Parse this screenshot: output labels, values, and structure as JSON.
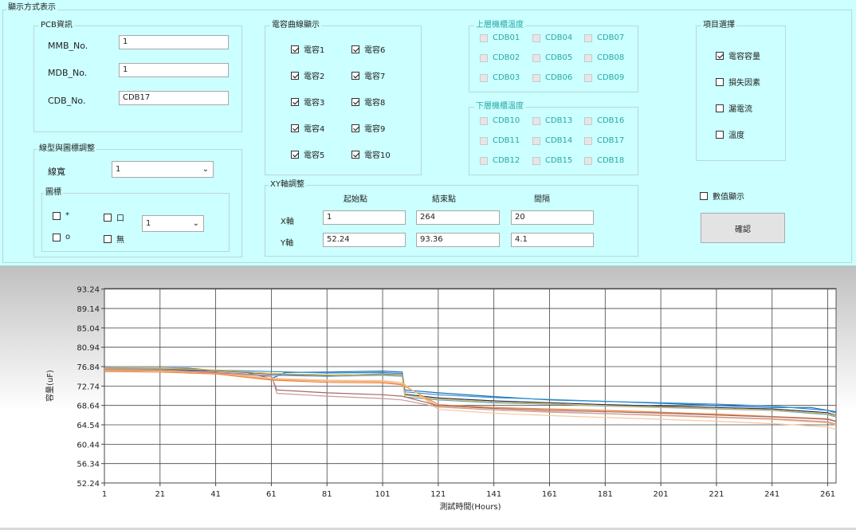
{
  "display_mode": {
    "title": "顯示方式表示"
  },
  "pcb": {
    "title": "PCB資訊",
    "mmb_label": "MMB_No.",
    "mmb_value": "1",
    "mdb_label": "MDB_No.",
    "mdb_value": "1",
    "cdb_label": "CDB_No.",
    "cdb_value": "CDB17"
  },
  "curves": {
    "title": "電容曲線顯示",
    "items": [
      {
        "label": "電容1",
        "checked": true
      },
      {
        "label": "電容2",
        "checked": true
      },
      {
        "label": "電容3",
        "checked": true
      },
      {
        "label": "電容4",
        "checked": true
      },
      {
        "label": "電容5",
        "checked": true
      },
      {
        "label": "電容6",
        "checked": true
      },
      {
        "label": "電容7",
        "checked": true
      },
      {
        "label": "電容8",
        "checked": true
      },
      {
        "label": "電容9",
        "checked": true
      },
      {
        "label": "電容10",
        "checked": true
      }
    ]
  },
  "upper_temp": {
    "title": "上層機櫃溫度",
    "items": [
      "CDB01",
      "CDB04",
      "CDB07",
      "CDB02",
      "CDB05",
      "CDB08",
      "CDB03",
      "CDB06",
      "CDB09"
    ]
  },
  "lower_temp": {
    "title": "下層機櫃溫度",
    "items": [
      "CDB10",
      "CDB13",
      "CDB16",
      "CDB11",
      "CDB14",
      "CDB17",
      "CDB12",
      "CDB15",
      "CDB18"
    ]
  },
  "items_select": {
    "title": "項目選擇",
    "items": [
      {
        "label": "電容容量",
        "checked": true
      },
      {
        "label": "損失因素",
        "checked": false
      },
      {
        "label": "漏電流",
        "checked": false
      },
      {
        "label": "溫度",
        "checked": false
      }
    ]
  },
  "line_style": {
    "title": "線型與圖標調整",
    "width_label": "線寬",
    "width_value": "1",
    "icon_title": "圖標",
    "icon_opts": [
      {
        "label": "*",
        "checked": false
      },
      {
        "label": "口",
        "checked": false
      },
      {
        "label": "o",
        "checked": false
      },
      {
        "label": "無",
        "checked": false
      }
    ],
    "icon_size_value": "1"
  },
  "xy": {
    "title": "XY軸調整",
    "col_start": "起始點",
    "col_end": "結束點",
    "col_interval": "間隔",
    "x_label": "X軸",
    "x_start": "1",
    "x_end": "264",
    "x_interval": "20",
    "y_label": "Y軸",
    "y_start": "52.24",
    "y_end": "93.36",
    "y_interval": "4.1"
  },
  "value_display": {
    "label": "數值顯示",
    "checked": false
  },
  "confirm_button": "確認",
  "colors": {
    "panel_bg": "#ccffff",
    "disabled_text": "#2aa7a7"
  },
  "chart_data": {
    "type": "line",
    "xlabel": "測試時間(Hours)",
    "ylabel": "容量(uF)",
    "xlim": [
      1,
      264
    ],
    "ylim": [
      52.24,
      93.36
    ],
    "xticks": [
      1,
      21,
      41,
      61,
      81,
      101,
      121,
      141,
      161,
      181,
      201,
      221,
      241,
      261
    ],
    "yticks": [
      "52.24",
      "56.34",
      "60.44",
      "64.54",
      "68.64",
      "72.74",
      "76.84",
      "80.94",
      "85.04",
      "89.14",
      "93.24"
    ],
    "grid": true,
    "series": [
      {
        "color": "#1f6fb4",
        "x": [
          1,
          31,
          41,
          51,
          61,
          66,
          81,
          101,
          108,
          109,
          121,
          141,
          161,
          181,
          201,
          221,
          241,
          255,
          264
        ],
        "values": [
          76.6,
          76.5,
          76.0,
          75.8,
          74.3,
          75.6,
          75.7,
          75.9,
          75.7,
          71.9,
          71.3,
          70.5,
          69.8,
          69.5,
          69.1,
          68.6,
          68.2,
          68.2,
          67.3
        ]
      },
      {
        "color": "#2f8fd0",
        "x": [
          1,
          21,
          41,
          61,
          81,
          101,
          108,
          109,
          121,
          141,
          161,
          181,
          201,
          221,
          241,
          261,
          264
        ],
        "values": [
          76.4,
          76.4,
          76.1,
          75.8,
          75.5,
          75.6,
          75.4,
          71.5,
          70.9,
          70.3,
          69.9,
          69.5,
          69.2,
          68.9,
          68.5,
          67.6,
          67.0
        ]
      },
      {
        "color": "#1b2f6e",
        "x": [
          1,
          21,
          41,
          61,
          81,
          101,
          108,
          109,
          121,
          141,
          161,
          181,
          201,
          221,
          241,
          261,
          264
        ],
        "values": [
          76.3,
          76.2,
          76.0,
          75.3,
          75.0,
          75.3,
          75.1,
          71.0,
          70.2,
          69.6,
          69.2,
          68.8,
          68.5,
          68.2,
          67.9,
          67.1,
          66.5
        ]
      },
      {
        "color": "#5c9ecf",
        "x": [
          1,
          21,
          41,
          61,
          81,
          101,
          108,
          109,
          121,
          141,
          161,
          181,
          201,
          221,
          241,
          261,
          264
        ],
        "values": [
          76.2,
          76.1,
          75.7,
          75.0,
          74.8,
          75.0,
          74.8,
          70.4,
          69.8,
          69.2,
          68.9,
          68.5,
          68.2,
          67.9,
          67.6,
          66.7,
          66.2
        ]
      },
      {
        "color": "#f08030",
        "x": [
          1,
          21,
          41,
          61,
          81,
          101,
          108,
          121,
          141,
          161,
          181,
          201,
          221,
          241,
          261,
          264
        ],
        "values": [
          75.8,
          75.7,
          75.3,
          74.0,
          73.5,
          73.4,
          73.0,
          68.8,
          68.2,
          67.9,
          67.6,
          67.2,
          66.8,
          66.3,
          65.8,
          65.3
        ]
      },
      {
        "color": "#f4a56a",
        "x": [
          1,
          21,
          41,
          61,
          81,
          101,
          108,
          121,
          141,
          161,
          181,
          201,
          221,
          241,
          261,
          264
        ],
        "values": [
          76.0,
          75.9,
          75.5,
          74.2,
          73.8,
          73.7,
          73.2,
          68.3,
          67.7,
          67.3,
          66.9,
          66.5,
          66.1,
          65.7,
          65.0,
          64.5
        ]
      },
      {
        "color": "#f7c89e",
        "x": [
          1,
          21,
          41,
          61,
          81,
          101,
          108,
          121,
          141,
          161,
          181,
          201,
          221,
          241,
          261,
          264
        ],
        "values": [
          76.1,
          75.9,
          75.6,
          74.4,
          74.0,
          73.9,
          73.5,
          67.8,
          67.0,
          66.5,
          66.1,
          65.7,
          65.3,
          64.8,
          64.1,
          63.5
        ]
      },
      {
        "color": "#a06a66",
        "x": [
          1,
          21,
          41,
          61,
          63,
          81,
          101,
          108,
          121,
          141,
          161,
          181,
          201,
          221,
          241,
          261,
          264
        ],
        "values": [
          76.2,
          76.1,
          75.6,
          74.8,
          71.9,
          71.3,
          70.9,
          70.6,
          68.6,
          68.0,
          67.6,
          67.3,
          67.0,
          66.6,
          66.2,
          65.7,
          65.2
        ]
      },
      {
        "color": "#c89a98",
        "x": [
          1,
          21,
          41,
          61,
          63,
          81,
          101,
          108,
          121,
          141,
          161,
          181,
          201,
          221,
          241,
          261,
          264
        ],
        "values": [
          76.3,
          76.2,
          75.7,
          74.9,
          71.2,
          70.6,
          70.1,
          69.8,
          68.3,
          67.7,
          67.2,
          66.9,
          66.6,
          66.2,
          65.8,
          65.2,
          64.7
        ]
      },
      {
        "color": "#f0c040",
        "x": [
          1,
          21,
          41,
          61,
          81,
          101,
          108,
          109,
          121,
          141,
          161,
          181,
          201,
          221,
          241,
          261,
          264
        ],
        "values": [
          76.5,
          76.5,
          76.1,
          75.4,
          75.1,
          75.2,
          75.0,
          70.8,
          70.0,
          69.4,
          69.0,
          68.6,
          68.3,
          68.0,
          67.7,
          66.9,
          66.4
        ]
      }
    ]
  }
}
